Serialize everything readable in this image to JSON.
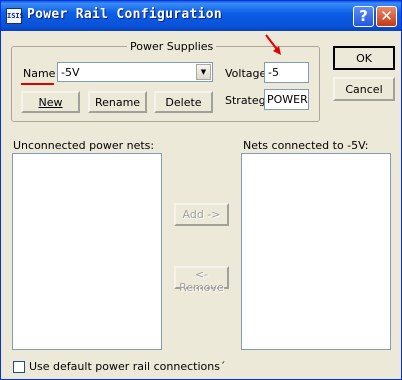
{
  "window": {
    "title": "Power Rail Configuration",
    "app_icon_text": "ISIS",
    "help_glyph": "?",
    "close_glyph": "✕"
  },
  "power_supplies": {
    "group_title": "Power Supplies",
    "name_label": "Name",
    "name_value": "-5V",
    "voltage_label": "Voltage",
    "voltage_value": "-5",
    "strategy_label": "Strateg",
    "strategy_value": "POWER",
    "new_button": "New",
    "rename_button": "Rename",
    "delete_button": "Delete"
  },
  "dialog_buttons": {
    "ok": "OK",
    "cancel": "Cancel"
  },
  "nets": {
    "unconnected_label": "Unconnected power nets:",
    "connected_label": "Nets connected to -5V:",
    "unconnected_items": [],
    "connected_items": [],
    "add_button": "Add ->",
    "remove_button": "<- Remove"
  },
  "options": {
    "default_connections_label": "Use default power rail connections´",
    "default_connections_checked": false
  },
  "annotation": {
    "arrow_color": "#e00000"
  },
  "colors": {
    "titlebar": "#0a5be9",
    "face": "#ece9d8",
    "field_border": "#7f9db9"
  }
}
